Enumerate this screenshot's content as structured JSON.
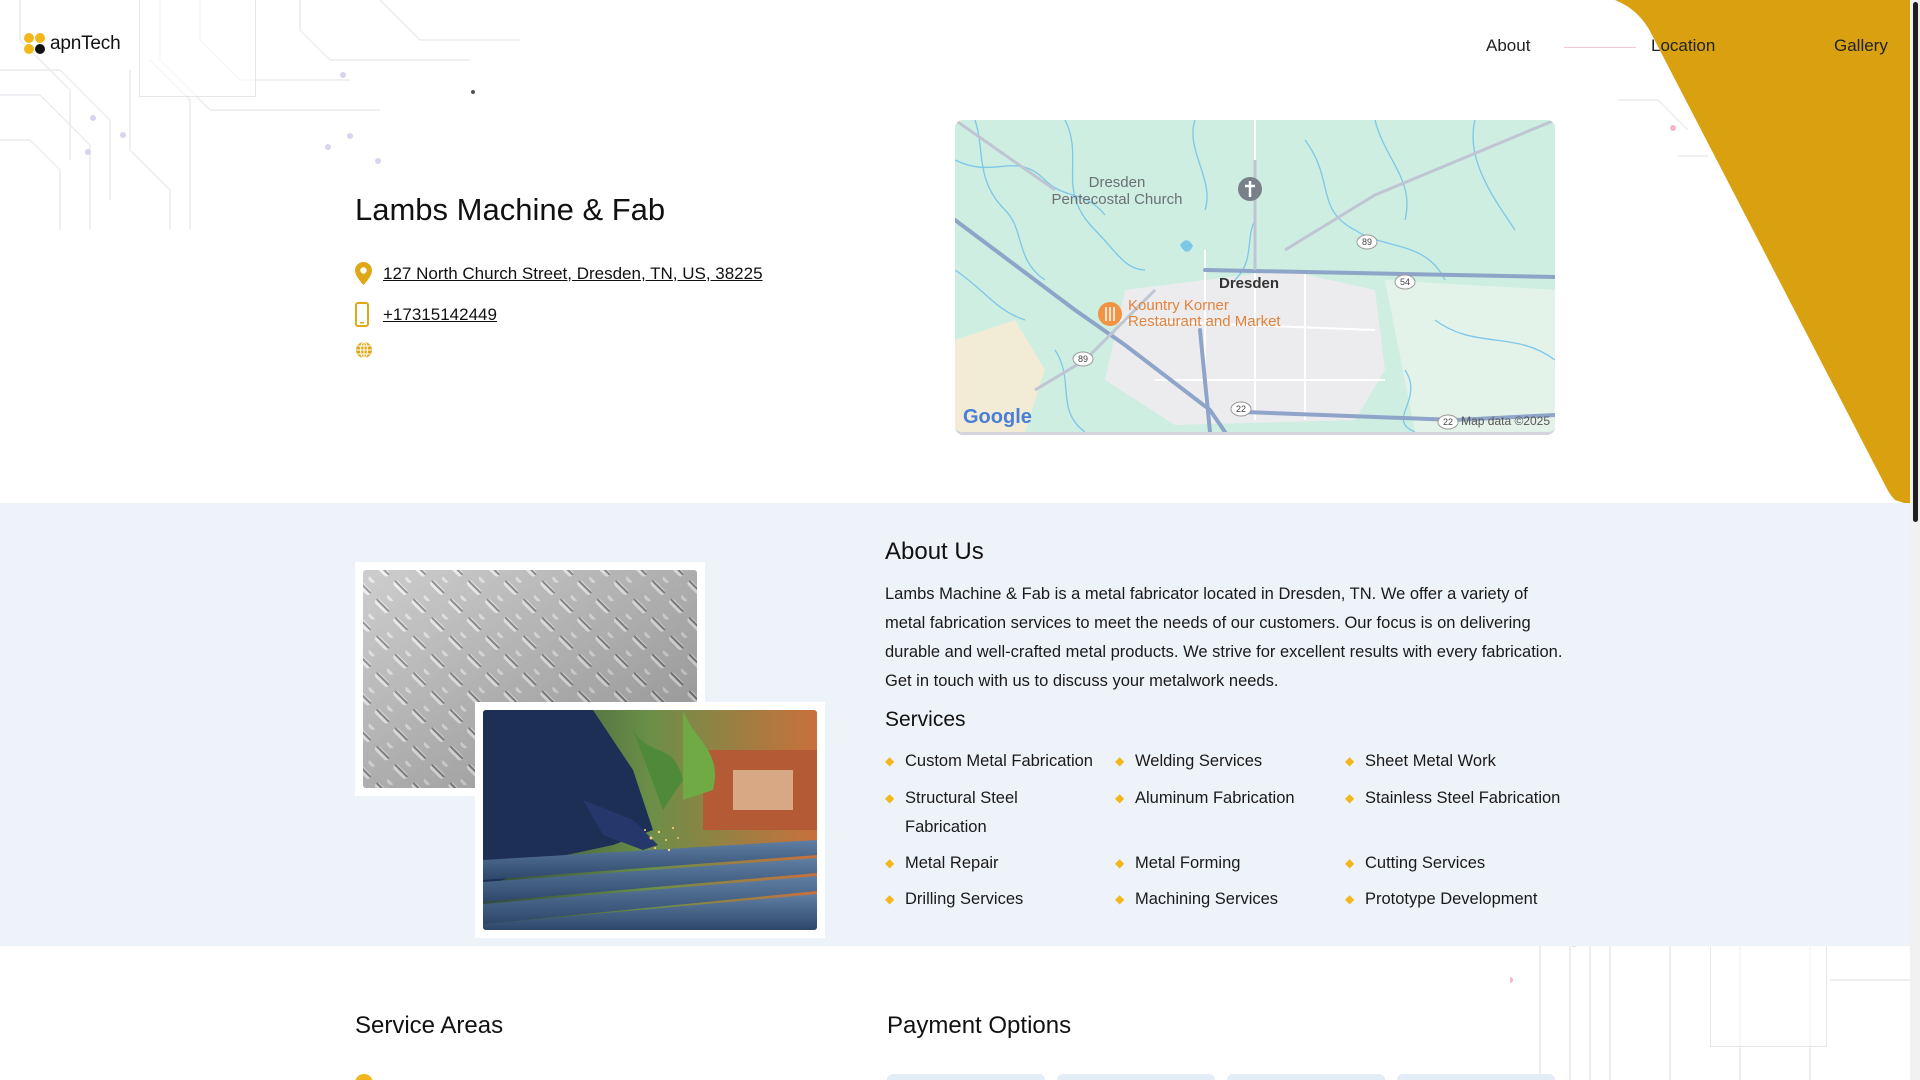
{
  "header": {
    "logo_text": "apnTech",
    "nav": {
      "about": "About",
      "location": "Location",
      "gallery": "Gallery"
    }
  },
  "business": {
    "name": "Lambs Machine & Fab",
    "address": "127 North Church Street, Dresden, TN, US, 38225",
    "phone": "+17315142449"
  },
  "map": {
    "town": "Dresden",
    "church": [
      "Dresden",
      "Pentecostal Church"
    ],
    "restaurant": [
      "Kountry Korner",
      "Restaurant and Market"
    ],
    "routes": {
      "r89a": "89",
      "r89b": "89",
      "r54": "54",
      "r22a": "22",
      "r22b": "22"
    },
    "brand": "Google",
    "attribution": "Map data ©2025"
  },
  "about": {
    "title": "About Us",
    "text": "Lambs Machine & Fab is a metal fabricator located in Dresden, TN. We offer a variety of metal fabrication services to meet the needs of our customers. Our focus is on delivering durable and well-crafted metal products. We strive for excellent results with every fabrication. Get in touch with us to discuss your metalwork needs.",
    "services_title": "Services",
    "services": [
      "Custom Metal Fabrication",
      "Welding Services",
      "Sheet Metal Work",
      "Structural Steel Fabrication",
      "Aluminum Fabrication",
      "Stainless Steel Fabrication",
      "Metal Repair",
      "Metal Forming",
      "Cutting Services",
      "Drilling Services",
      "Machining Services",
      "Prototype Development"
    ]
  },
  "sections": {
    "service_areas": "Service Areas",
    "payment_options": "Payment Options"
  },
  "colors": {
    "accent_yellow": "#d9a10f",
    "bullet_yellow": "#f3b71b",
    "band_bg": "#eef2f9"
  },
  "icons": [
    "location-pin-icon",
    "phone-icon",
    "globe-icon",
    "diamond-bullet-icon"
  ]
}
